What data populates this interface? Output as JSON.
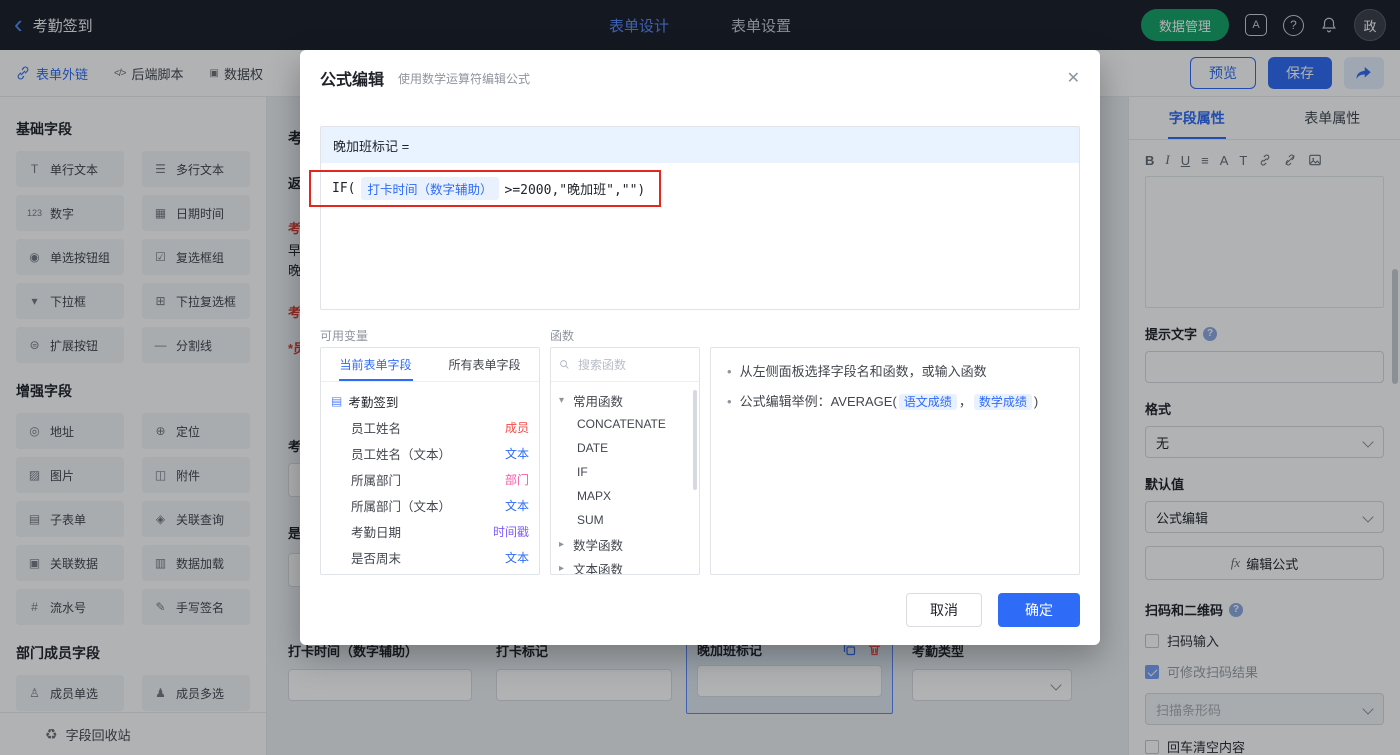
{
  "colors": {
    "accent": "#2e6bf6",
    "header_bg": "#1a1e28",
    "green_button": "#15a368",
    "annotation_red": "#e1271e",
    "tag_member": "#f54a45",
    "tag_text": "#2e6bf6",
    "tag_dept": "#f759ab",
    "tag_timestamp": "#7f5cff"
  },
  "icons": {
    "back": "‹",
    "close": "✕",
    "caret_down": "▾",
    "caret_right": "▸",
    "bullet": "•",
    "doc": "▤",
    "fx": "fx",
    "recycle": "♻",
    "question": "?",
    "code": "</>",
    "perm": "▣",
    "lang": "A"
  },
  "header": {
    "back_label": "考勤签到",
    "tabs": [
      {
        "label": "表单设计"
      },
      {
        "label": "表单设置"
      }
    ],
    "data_manage": "数据管理",
    "avatar": "政"
  },
  "toolbar": {
    "links": [
      "表单外链",
      "后端脚本",
      "数据权"
    ],
    "preview": "预览",
    "save": "保存"
  },
  "sidebar": {
    "sections": [
      {
        "title": "基础字段",
        "items": [
          {
            "icon": "T",
            "label": "单行文本"
          },
          {
            "icon": "☰",
            "label": "多行文本"
          },
          {
            "icon": "123",
            "label": "数字"
          },
          {
            "icon": "▦",
            "label": "日期时间"
          },
          {
            "icon": "◉",
            "label": "单选按钮组"
          },
          {
            "icon": "☑",
            "label": "复选框组"
          },
          {
            "icon": "▾",
            "label": "下拉框"
          },
          {
            "icon": "⊞",
            "label": "下拉复选框"
          },
          {
            "icon": "⊜",
            "label": "扩展按钮"
          },
          {
            "icon": "—",
            "label": "分割线"
          }
        ]
      },
      {
        "title": "增强字段",
        "items": [
          {
            "icon": "◎",
            "label": "地址"
          },
          {
            "icon": "⊕",
            "label": "定位"
          },
          {
            "icon": "▨",
            "label": "图片"
          },
          {
            "icon": "◫",
            "label": "附件"
          },
          {
            "icon": "▤",
            "label": "子表单"
          },
          {
            "icon": "◈",
            "label": "关联查询"
          },
          {
            "icon": "▣",
            "label": "关联数据"
          },
          {
            "icon": "▥",
            "label": "数据加载"
          },
          {
            "icon": "#",
            "label": "流水号"
          },
          {
            "icon": "✎",
            "label": "手写签名"
          }
        ]
      },
      {
        "title": "部门成员字段",
        "items": [
          {
            "icon": "♙",
            "label": "成员单选"
          },
          {
            "icon": "♟",
            "label": "成员多选"
          }
        ]
      }
    ],
    "recycle": "字段回收站"
  },
  "canvas": {
    "partials": [
      "考",
      "返",
      "考",
      "早",
      "晚",
      "考",
      "*员",
      "考",
      "是"
    ],
    "fields": [
      {
        "label": "打卡时间（数字辅助）"
      },
      {
        "label": "打卡标记"
      },
      {
        "label": "晚加班标记"
      },
      {
        "label": "考勤类型"
      }
    ]
  },
  "modal": {
    "title": "公式编辑",
    "subtitle": "使用数学运算符编辑公式",
    "target": "晚加班标记 =",
    "formula": {
      "fn": "IF(",
      "field": "打卡时间（数字辅助）",
      "rest": ">=2000,\"晚加班\",\"\")"
    },
    "vars_label": "可用变量",
    "funcs_label": "函数",
    "vars": {
      "tabs": [
        {
          "label": "当前表单字段"
        },
        {
          "label": "所有表单字段"
        }
      ],
      "form_name": "考勤签到",
      "items": [
        {
          "label": "员工姓名",
          "tag": "成员"
        },
        {
          "label": "员工姓名（文本）",
          "tag": "文本"
        },
        {
          "label": "所属部门",
          "tag": "部门"
        },
        {
          "label": "所属部门（文本）",
          "tag": "文本"
        },
        {
          "label": "考勤日期",
          "tag": "时间戳"
        },
        {
          "label": "是否周末",
          "tag": "文本"
        }
      ]
    },
    "funcs": {
      "search_placeholder": "搜索函数",
      "groups": [
        {
          "label": "常用函数",
          "items": [
            "CONCATENATE",
            "DATE",
            "IF",
            "MAPX",
            "SUM"
          ]
        },
        {
          "label": "数学函数"
        },
        {
          "label": "文本函数"
        }
      ]
    },
    "help": {
      "line1": "从左侧面板选择字段名和函数，或输入函数",
      "line2_prefix": "公式编辑举例：AVERAGE(",
      "token1": "语文成绩",
      "sep": "，",
      "token2": "数学成绩",
      "line2_suffix": ")"
    },
    "cancel": "取消",
    "ok": "确定"
  },
  "panel": {
    "tabs": [
      {
        "label": "字段属性"
      },
      {
        "label": "表单属性"
      }
    ],
    "format_icons": [
      "B",
      "I",
      "U",
      "≡",
      "A",
      "T"
    ],
    "hint_label": "提示文字",
    "format_label": "格式",
    "format_value": "无",
    "default_label": "默认值",
    "default_value": "公式编辑",
    "edit_formula": "编辑公式",
    "scan_section": "扫码和二维码",
    "scan_input": "扫码输入",
    "scan_modifiable": "可修改扫码结果",
    "scan_barcode": "扫描条形码",
    "enter_clear": "回车清空内容"
  }
}
